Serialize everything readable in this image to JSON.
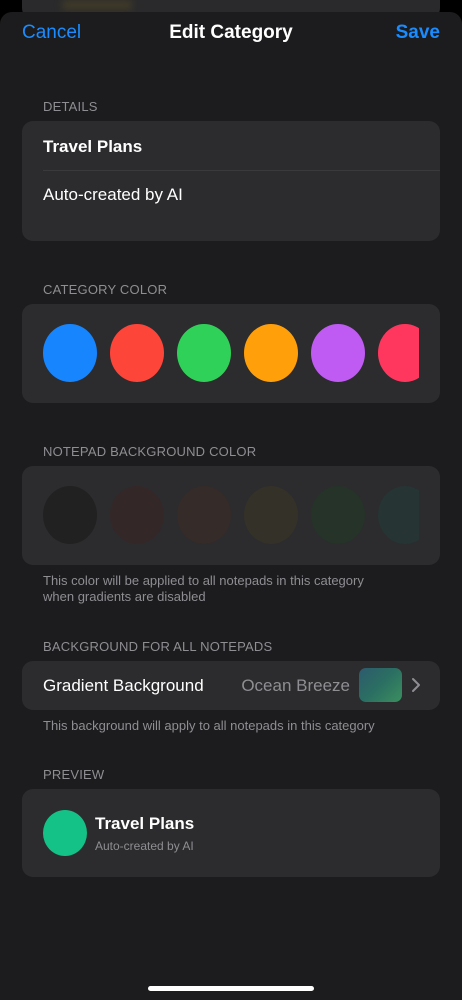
{
  "nav": {
    "cancel_label": "Cancel",
    "title": "Edit Category",
    "save_label": "Save"
  },
  "details": {
    "section_label": "DETAILS",
    "name_value": "Travel Plans",
    "description_value": "Auto-created by AI"
  },
  "category_color": {
    "section_label": "CATEGORY COLOR",
    "swatches": [
      "#1785fe",
      "#fe453a",
      "#30d158",
      "#ff9f0a",
      "#bf5af2",
      "#ff375f"
    ]
  },
  "notepad_bg": {
    "section_label": "NOTEPAD BACKGROUND COLOR",
    "swatches": [
      "#151515",
      "#3b2122",
      "#3e2a22",
      "#3c3522",
      "#1e3a24",
      "#1f3c3a"
    ],
    "footnote_line1": "This color will be applied to all notepads in this category",
    "footnote_line2": "when gradients are disabled"
  },
  "all_notepads_bg": {
    "section_label": "BACKGROUND FOR ALL NOTEPADS",
    "row_label": "Gradient Background",
    "row_value": "Ocean Breeze",
    "footnote": "This background will apply to all notepads in this category"
  },
  "preview": {
    "section_label": "PREVIEW",
    "name": "Travel Plans",
    "description": "Auto-created by AI",
    "avatar_color": "#14c287"
  },
  "colors": {
    "accent": "#1a8cff",
    "background": "#1c1c1e",
    "card": "#2c2c2e"
  }
}
